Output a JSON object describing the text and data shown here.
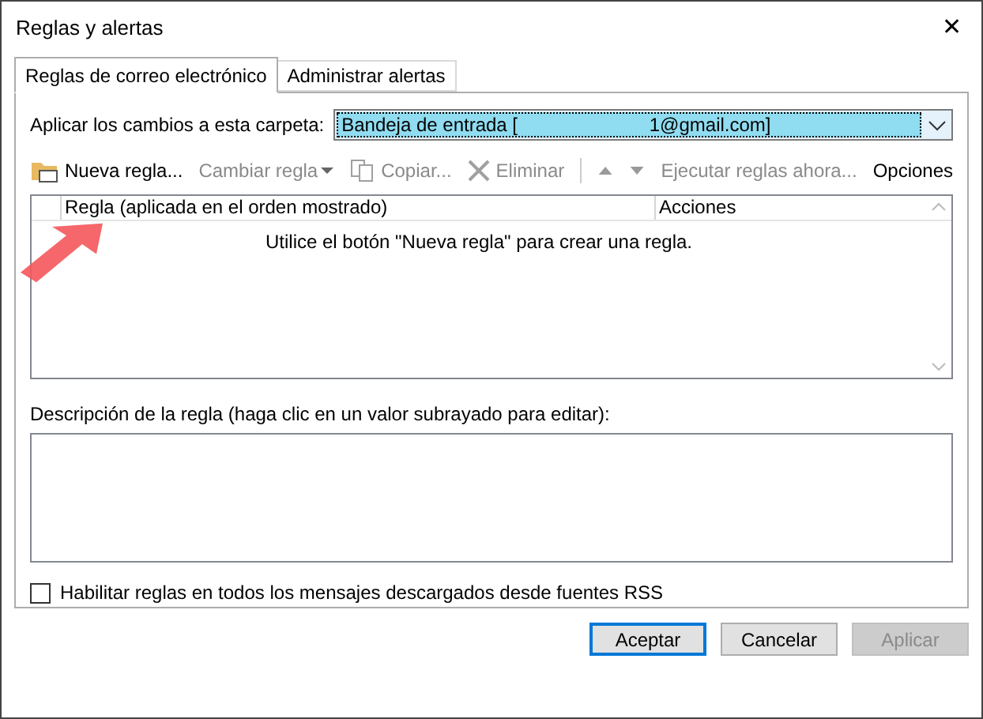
{
  "window": {
    "title": "Reglas y alertas",
    "close": "✕"
  },
  "tabs": [
    {
      "label": "Reglas de correo electrónico",
      "selected": true
    },
    {
      "label": "Administrar alertas",
      "selected": false
    }
  ],
  "folder": {
    "label": "Aplicar los cambios a esta carpeta:",
    "value": "Bandeja de entrada [                         1@gmail.com]"
  },
  "toolbar": [
    {
      "kind": "new",
      "label": "Nueva regla...",
      "disabled": false
    },
    {
      "kind": "dropdown",
      "label": "Cambiar regla",
      "disabled": true
    },
    {
      "kind": "copy",
      "label": "Copiar...",
      "disabled": true
    },
    {
      "kind": "delete",
      "label": "Eliminar",
      "disabled": true
    },
    {
      "kind": "separator"
    },
    {
      "kind": "up",
      "disabled": true
    },
    {
      "kind": "down",
      "disabled": true
    },
    {
      "kind": "text",
      "label": "Ejecutar reglas ahora...",
      "disabled": true
    },
    {
      "kind": "text",
      "label": "Opciones",
      "disabled": false
    }
  ],
  "rules_table": {
    "columns": [
      "Regla (aplicada en el orden mostrado)",
      "Acciones"
    ],
    "empty_message": "Utilice el botón \"Nueva regla\" para crear una regla."
  },
  "description": {
    "label": "Descripción de la regla (haga clic en un valor subrayado para editar):"
  },
  "rss_checkbox": {
    "label": "Habilitar reglas en todos los mensajes descargados desde fuentes RSS",
    "checked": false
  },
  "buttons": [
    {
      "label": "Aceptar",
      "default": true,
      "disabled": false
    },
    {
      "label": "Cancelar",
      "default": false,
      "disabled": false
    },
    {
      "label": "Aplicar",
      "default": false,
      "disabled": true
    }
  ],
  "annotation": {
    "kind": "arrow"
  }
}
